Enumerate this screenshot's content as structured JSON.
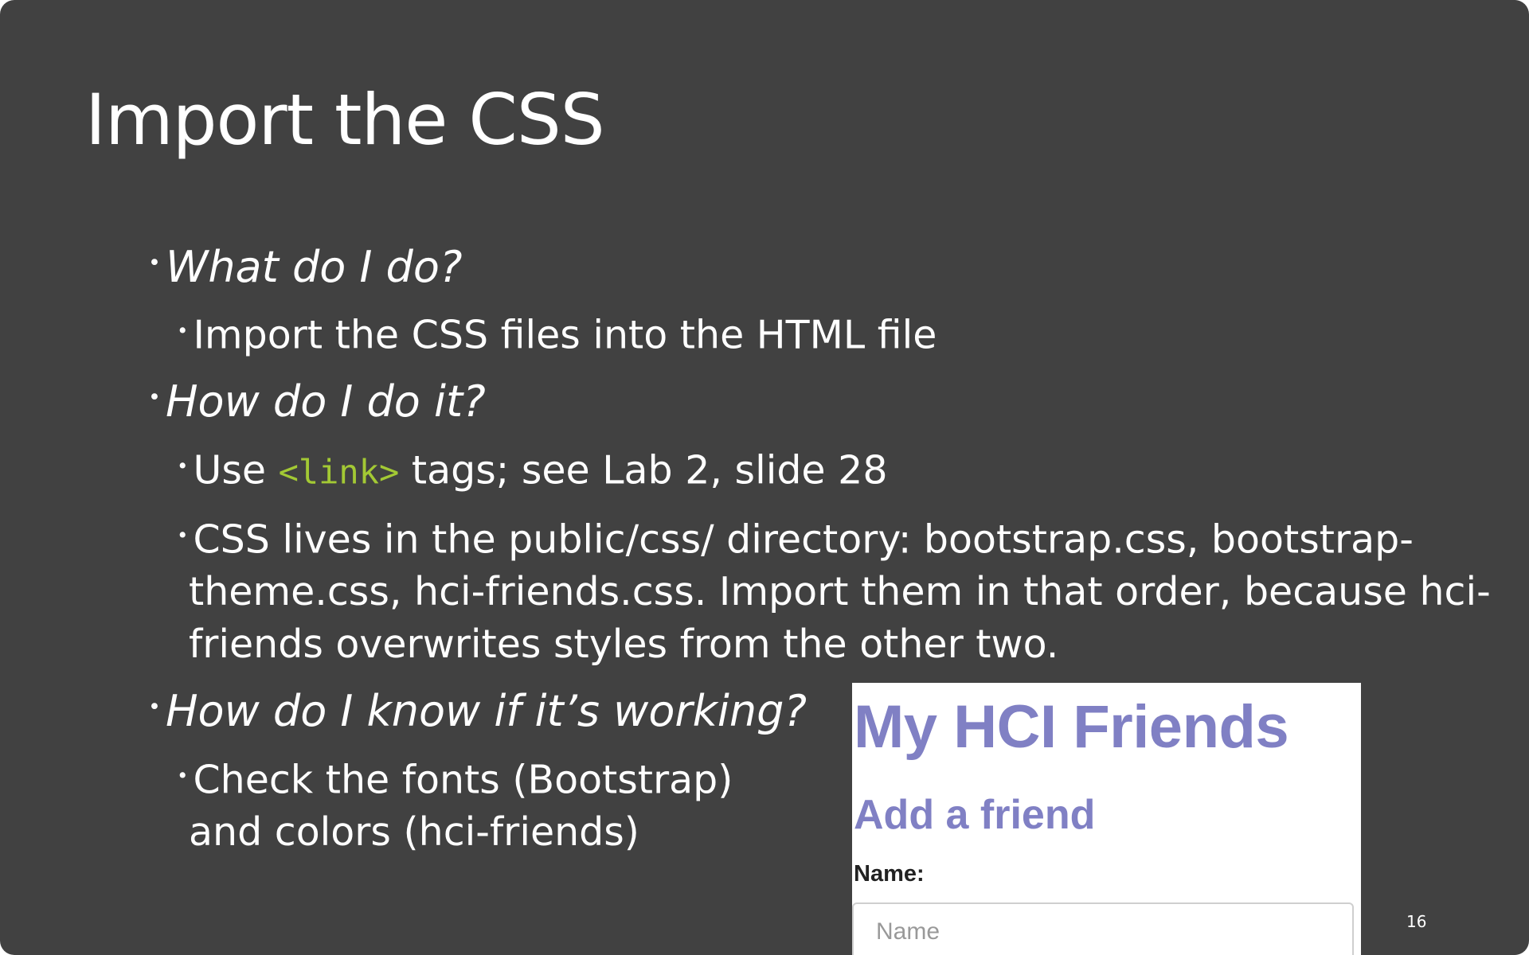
{
  "slide": {
    "title": "Import the CSS",
    "page_number": "16",
    "bullet_symbol": "•",
    "bullets": {
      "q1": "What do I do?",
      "a1": "Import the CSS files into the HTML file",
      "q2": "How do I do it?",
      "a2_pre": "Use ",
      "a2_code": "<link>",
      "a2_post": " tags; see Lab 2, slide 28",
      "a3_line1": "CSS lives in the public/css/ directory: bootstrap.css, bootstrap-",
      "a3_line2": "theme.css, hci-friends.css. Import them in that order, because hci-",
      "a3_line3": "friends overwrites styles from the other two.",
      "q3": "How do I know if it’s working?",
      "a4_line1": "Check the fonts (Bootstrap)",
      "a4_line2": "and colors (hci-friends)"
    }
  },
  "screenshot": {
    "heading": "My HCI Friends",
    "subheading": "Add a friend",
    "name_label": "Name:",
    "name_placeholder": "Name"
  },
  "colors": {
    "slide_background": "#414141",
    "code_color": "#a3c934",
    "heading_color": "#8080c4"
  }
}
